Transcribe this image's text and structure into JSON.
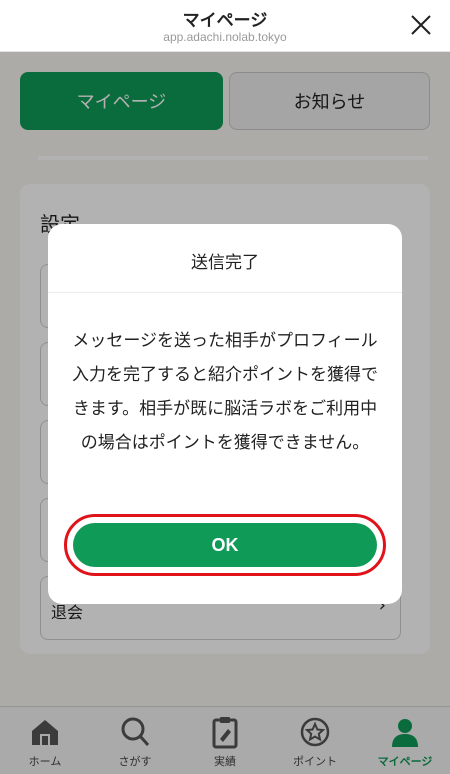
{
  "browser": {
    "title": "マイページ",
    "url": "app.adachi.nolab.tokyo"
  },
  "tabs": [
    {
      "label": "マイページ",
      "active": true
    },
    {
      "label": "お知らせ",
      "active": false
    }
  ],
  "settings": {
    "title": "設定",
    "items": [
      {
        "label": ""
      },
      {
        "label": ""
      },
      {
        "label": ""
      },
      {
        "label": ""
      },
      {
        "label": "退会"
      }
    ]
  },
  "modal": {
    "title": "送信完了",
    "message": "メッセージを送った相手がプロフィール入力を完了すると紹介ポイントを獲得できます。相手が既に脳活ラボをご利用中の場合はポイントを獲得できません。",
    "ok_label": "OK"
  },
  "bottom_nav": [
    {
      "label": "ホーム",
      "icon": "home-icon"
    },
    {
      "label": "さがす",
      "icon": "search-icon"
    },
    {
      "label": "実績",
      "icon": "clipboard-icon"
    },
    {
      "label": "ポイント",
      "icon": "point-icon"
    },
    {
      "label": "マイページ",
      "icon": "person-icon",
      "active": true
    }
  ],
  "colors": {
    "accent": "#0f9a57",
    "highlight": "#e0131b"
  }
}
